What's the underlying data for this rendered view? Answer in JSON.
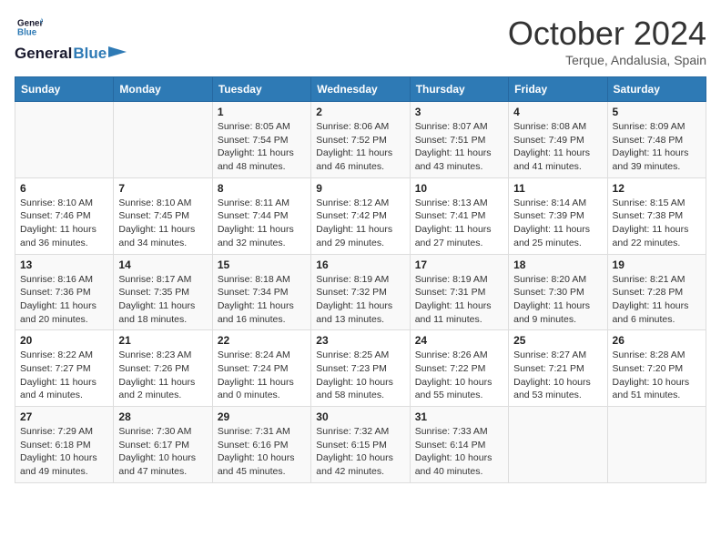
{
  "header": {
    "logo_general": "General",
    "logo_blue": "Blue",
    "month_title": "October 2024",
    "location": "Terque, Andalusia, Spain"
  },
  "weekdays": [
    "Sunday",
    "Monday",
    "Tuesday",
    "Wednesday",
    "Thursday",
    "Friday",
    "Saturday"
  ],
  "weeks": [
    [
      {
        "day": "",
        "sunrise": "",
        "sunset": "",
        "daylight": ""
      },
      {
        "day": "",
        "sunrise": "",
        "sunset": "",
        "daylight": ""
      },
      {
        "day": "1",
        "sunrise": "Sunrise: 8:05 AM",
        "sunset": "Sunset: 7:54 PM",
        "daylight": "Daylight: 11 hours and 48 minutes."
      },
      {
        "day": "2",
        "sunrise": "Sunrise: 8:06 AM",
        "sunset": "Sunset: 7:52 PM",
        "daylight": "Daylight: 11 hours and 46 minutes."
      },
      {
        "day": "3",
        "sunrise": "Sunrise: 8:07 AM",
        "sunset": "Sunset: 7:51 PM",
        "daylight": "Daylight: 11 hours and 43 minutes."
      },
      {
        "day": "4",
        "sunrise": "Sunrise: 8:08 AM",
        "sunset": "Sunset: 7:49 PM",
        "daylight": "Daylight: 11 hours and 41 minutes."
      },
      {
        "day": "5",
        "sunrise": "Sunrise: 8:09 AM",
        "sunset": "Sunset: 7:48 PM",
        "daylight": "Daylight: 11 hours and 39 minutes."
      }
    ],
    [
      {
        "day": "6",
        "sunrise": "Sunrise: 8:10 AM",
        "sunset": "Sunset: 7:46 PM",
        "daylight": "Daylight: 11 hours and 36 minutes."
      },
      {
        "day": "7",
        "sunrise": "Sunrise: 8:10 AM",
        "sunset": "Sunset: 7:45 PM",
        "daylight": "Daylight: 11 hours and 34 minutes."
      },
      {
        "day": "8",
        "sunrise": "Sunrise: 8:11 AM",
        "sunset": "Sunset: 7:44 PM",
        "daylight": "Daylight: 11 hours and 32 minutes."
      },
      {
        "day": "9",
        "sunrise": "Sunrise: 8:12 AM",
        "sunset": "Sunset: 7:42 PM",
        "daylight": "Daylight: 11 hours and 29 minutes."
      },
      {
        "day": "10",
        "sunrise": "Sunrise: 8:13 AM",
        "sunset": "Sunset: 7:41 PM",
        "daylight": "Daylight: 11 hours and 27 minutes."
      },
      {
        "day": "11",
        "sunrise": "Sunrise: 8:14 AM",
        "sunset": "Sunset: 7:39 PM",
        "daylight": "Daylight: 11 hours and 25 minutes."
      },
      {
        "day": "12",
        "sunrise": "Sunrise: 8:15 AM",
        "sunset": "Sunset: 7:38 PM",
        "daylight": "Daylight: 11 hours and 22 minutes."
      }
    ],
    [
      {
        "day": "13",
        "sunrise": "Sunrise: 8:16 AM",
        "sunset": "Sunset: 7:36 PM",
        "daylight": "Daylight: 11 hours and 20 minutes."
      },
      {
        "day": "14",
        "sunrise": "Sunrise: 8:17 AM",
        "sunset": "Sunset: 7:35 PM",
        "daylight": "Daylight: 11 hours and 18 minutes."
      },
      {
        "day": "15",
        "sunrise": "Sunrise: 8:18 AM",
        "sunset": "Sunset: 7:34 PM",
        "daylight": "Daylight: 11 hours and 16 minutes."
      },
      {
        "day": "16",
        "sunrise": "Sunrise: 8:19 AM",
        "sunset": "Sunset: 7:32 PM",
        "daylight": "Daylight: 11 hours and 13 minutes."
      },
      {
        "day": "17",
        "sunrise": "Sunrise: 8:19 AM",
        "sunset": "Sunset: 7:31 PM",
        "daylight": "Daylight: 11 hours and 11 minutes."
      },
      {
        "day": "18",
        "sunrise": "Sunrise: 8:20 AM",
        "sunset": "Sunset: 7:30 PM",
        "daylight": "Daylight: 11 hours and 9 minutes."
      },
      {
        "day": "19",
        "sunrise": "Sunrise: 8:21 AM",
        "sunset": "Sunset: 7:28 PM",
        "daylight": "Daylight: 11 hours and 6 minutes."
      }
    ],
    [
      {
        "day": "20",
        "sunrise": "Sunrise: 8:22 AM",
        "sunset": "Sunset: 7:27 PM",
        "daylight": "Daylight: 11 hours and 4 minutes."
      },
      {
        "day": "21",
        "sunrise": "Sunrise: 8:23 AM",
        "sunset": "Sunset: 7:26 PM",
        "daylight": "Daylight: 11 hours and 2 minutes."
      },
      {
        "day": "22",
        "sunrise": "Sunrise: 8:24 AM",
        "sunset": "Sunset: 7:24 PM",
        "daylight": "Daylight: 11 hours and 0 minutes."
      },
      {
        "day": "23",
        "sunrise": "Sunrise: 8:25 AM",
        "sunset": "Sunset: 7:23 PM",
        "daylight": "Daylight: 10 hours and 58 minutes."
      },
      {
        "day": "24",
        "sunrise": "Sunrise: 8:26 AM",
        "sunset": "Sunset: 7:22 PM",
        "daylight": "Daylight: 10 hours and 55 minutes."
      },
      {
        "day": "25",
        "sunrise": "Sunrise: 8:27 AM",
        "sunset": "Sunset: 7:21 PM",
        "daylight": "Daylight: 10 hours and 53 minutes."
      },
      {
        "day": "26",
        "sunrise": "Sunrise: 8:28 AM",
        "sunset": "Sunset: 7:20 PM",
        "daylight": "Daylight: 10 hours and 51 minutes."
      }
    ],
    [
      {
        "day": "27",
        "sunrise": "Sunrise: 7:29 AM",
        "sunset": "Sunset: 6:18 PM",
        "daylight": "Daylight: 10 hours and 49 minutes."
      },
      {
        "day": "28",
        "sunrise": "Sunrise: 7:30 AM",
        "sunset": "Sunset: 6:17 PM",
        "daylight": "Daylight: 10 hours and 47 minutes."
      },
      {
        "day": "29",
        "sunrise": "Sunrise: 7:31 AM",
        "sunset": "Sunset: 6:16 PM",
        "daylight": "Daylight: 10 hours and 45 minutes."
      },
      {
        "day": "30",
        "sunrise": "Sunrise: 7:32 AM",
        "sunset": "Sunset: 6:15 PM",
        "daylight": "Daylight: 10 hours and 42 minutes."
      },
      {
        "day": "31",
        "sunrise": "Sunrise: 7:33 AM",
        "sunset": "Sunset: 6:14 PM",
        "daylight": "Daylight: 10 hours and 40 minutes."
      },
      {
        "day": "",
        "sunrise": "",
        "sunset": "",
        "daylight": ""
      },
      {
        "day": "",
        "sunrise": "",
        "sunset": "",
        "daylight": ""
      }
    ]
  ]
}
